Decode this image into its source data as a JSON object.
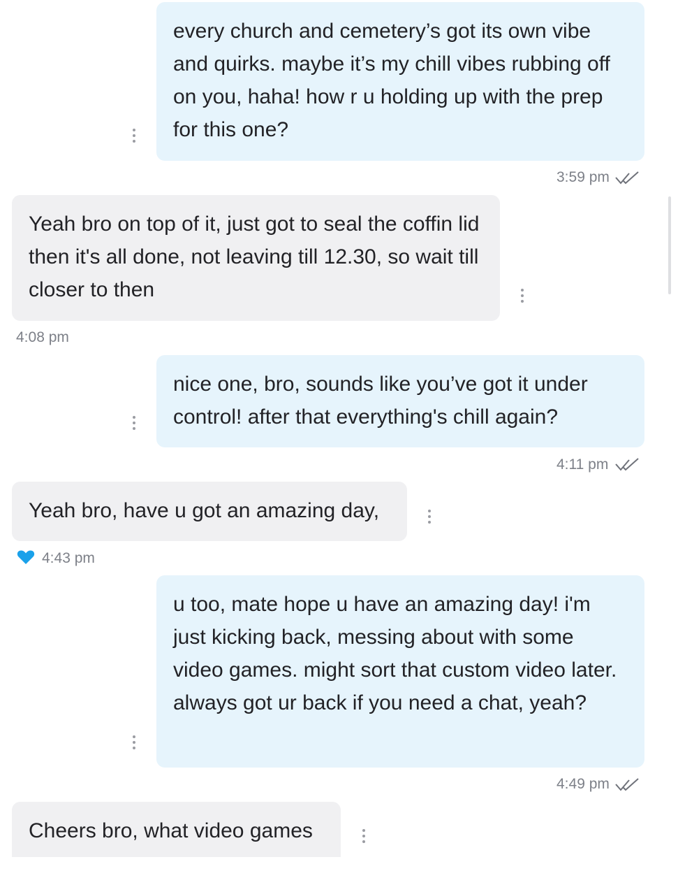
{
  "messages": [
    {
      "dir": "out",
      "text": "every church and cemetery’s got its own vibe and quirks. maybe it’s my chill vibes rubbing off on you, haha! how r u holding up with the prep for this one?",
      "time": "3:59 pm",
      "read": true
    },
    {
      "dir": "in",
      "text": "Yeah bro on top of it, just got to seal the coffin lid then it's all done, not leaving till 12.30, so wait till closer to then",
      "time": "4:08 pm"
    },
    {
      "dir": "out",
      "text": "nice one, bro, sounds like you’ve got it under control! after that everything's chill again?",
      "time": "4:11 pm",
      "read": true
    },
    {
      "dir": "in",
      "text": "Yeah bro, have u got an amazing day,",
      "time": "4:43 pm",
      "liked": true
    },
    {
      "dir": "out",
      "text": "u too, mate hope u have an amazing day! i'm just kicking back, messing about with some video games. might sort that custom video later. always got ur back if you need a chat, yeah?",
      "time": "4:49 pm",
      "read": true
    },
    {
      "dir": "in",
      "text": "Cheers bro, what video games"
    }
  ],
  "icons": {
    "more": "vertical-dots-icon",
    "read": "double-check-icon",
    "like": "heart-icon"
  },
  "colors": {
    "outgoing_bubble": "#e6f4fc",
    "incoming_bubble": "#f0f0f2",
    "heart": "#1aa1ea"
  }
}
